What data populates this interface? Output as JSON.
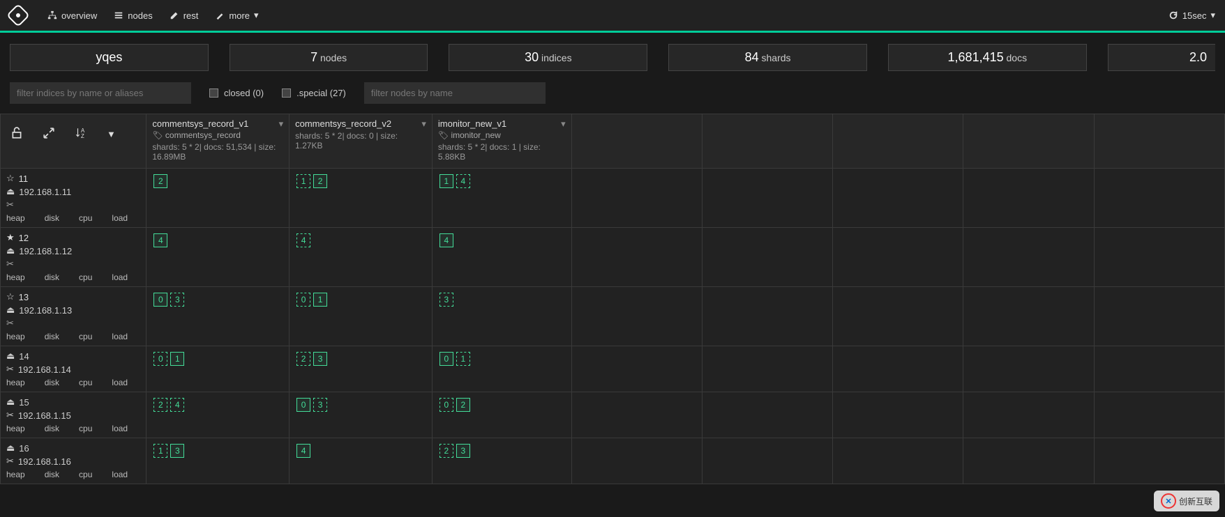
{
  "nav": {
    "overview": "overview",
    "nodes": "nodes",
    "rest": "rest",
    "more": "more",
    "refresh": "15sec"
  },
  "stats": {
    "cluster": "yqes",
    "nodes_num": "7",
    "nodes_label": "nodes",
    "indices_num": "30",
    "indices_label": "indices",
    "shards_num": "84",
    "shards_label": "shards",
    "docs_num": "1,681,415",
    "docs_label": "docs",
    "size": "2.0"
  },
  "filters": {
    "indices_placeholder": "filter indices by name or aliases",
    "nodes_placeholder": "filter nodes by name",
    "closed_label": "closed (0)",
    "special_label": ".special (27)"
  },
  "node_stat_headers": {
    "heap": "heap",
    "disk": "disk",
    "cpu": "cpu",
    "load": "load"
  },
  "indices": [
    {
      "name": "commentsys_record_v1",
      "alias": "commentsys_record",
      "info": "shards: 5 * 2| docs: 51,534 | size: 16.89MB"
    },
    {
      "name": "commentsys_record_v2",
      "alias": "",
      "info": "shards: 5 * 2| docs: 0 | size: 1.27KB"
    },
    {
      "name": "imonitor_new_v1",
      "alias": "imonitor_new",
      "info": "shards: 5 * 2| docs: 1 | size: 5.88KB"
    }
  ],
  "nodes": [
    {
      "id": "11",
      "ip": "192.168.1.11",
      "star": true,
      "crop": true,
      "cells": [
        [
          {
            "n": "2",
            "p": true
          }
        ],
        [
          {
            "n": "1",
            "p": false
          },
          {
            "n": "2",
            "p": true
          }
        ],
        [
          {
            "n": "1",
            "p": true
          },
          {
            "n": "4",
            "p": false
          }
        ]
      ]
    },
    {
      "id": "12",
      "ip": "192.168.1.12",
      "star": true,
      "starFilled": true,
      "crop": true,
      "cells": [
        [
          {
            "n": "4",
            "p": true
          }
        ],
        [
          {
            "n": "4",
            "p": false
          }
        ],
        [
          {
            "n": "4",
            "p": true
          }
        ]
      ]
    },
    {
      "id": "13",
      "ip": "192.168.1.13",
      "star": true,
      "crop": true,
      "cells": [
        [
          {
            "n": "0",
            "p": true
          },
          {
            "n": "3",
            "p": false
          }
        ],
        [
          {
            "n": "0",
            "p": false
          },
          {
            "n": "1",
            "p": true
          }
        ],
        [
          {
            "n": "3",
            "p": false
          }
        ]
      ]
    },
    {
      "id": "14",
      "ip": "192.168.1.14",
      "star": false,
      "crop": true,
      "cells": [
        [
          {
            "n": "0",
            "p": false
          },
          {
            "n": "1",
            "p": true
          }
        ],
        [
          {
            "n": "2",
            "p": false
          },
          {
            "n": "3",
            "p": true
          }
        ],
        [
          {
            "n": "0",
            "p": true
          },
          {
            "n": "1",
            "p": false
          }
        ]
      ]
    },
    {
      "id": "15",
      "ip": "192.168.1.15",
      "star": false,
      "crop": true,
      "cells": [
        [
          {
            "n": "2",
            "p": false
          },
          {
            "n": "4",
            "p": false
          }
        ],
        [
          {
            "n": "0",
            "p": true
          },
          {
            "n": "3",
            "p": false
          }
        ],
        [
          {
            "n": "0",
            "p": false
          },
          {
            "n": "2",
            "p": true
          }
        ]
      ]
    },
    {
      "id": "16",
      "ip": "192.168.1.16",
      "star": false,
      "crop": true,
      "cells": [
        [
          {
            "n": "1",
            "p": false
          },
          {
            "n": "3",
            "p": true
          }
        ],
        [
          {
            "n": "4",
            "p": true
          }
        ],
        [
          {
            "n": "2",
            "p": false
          },
          {
            "n": "3",
            "p": true
          }
        ]
      ]
    }
  ],
  "watermark": "创新互联"
}
